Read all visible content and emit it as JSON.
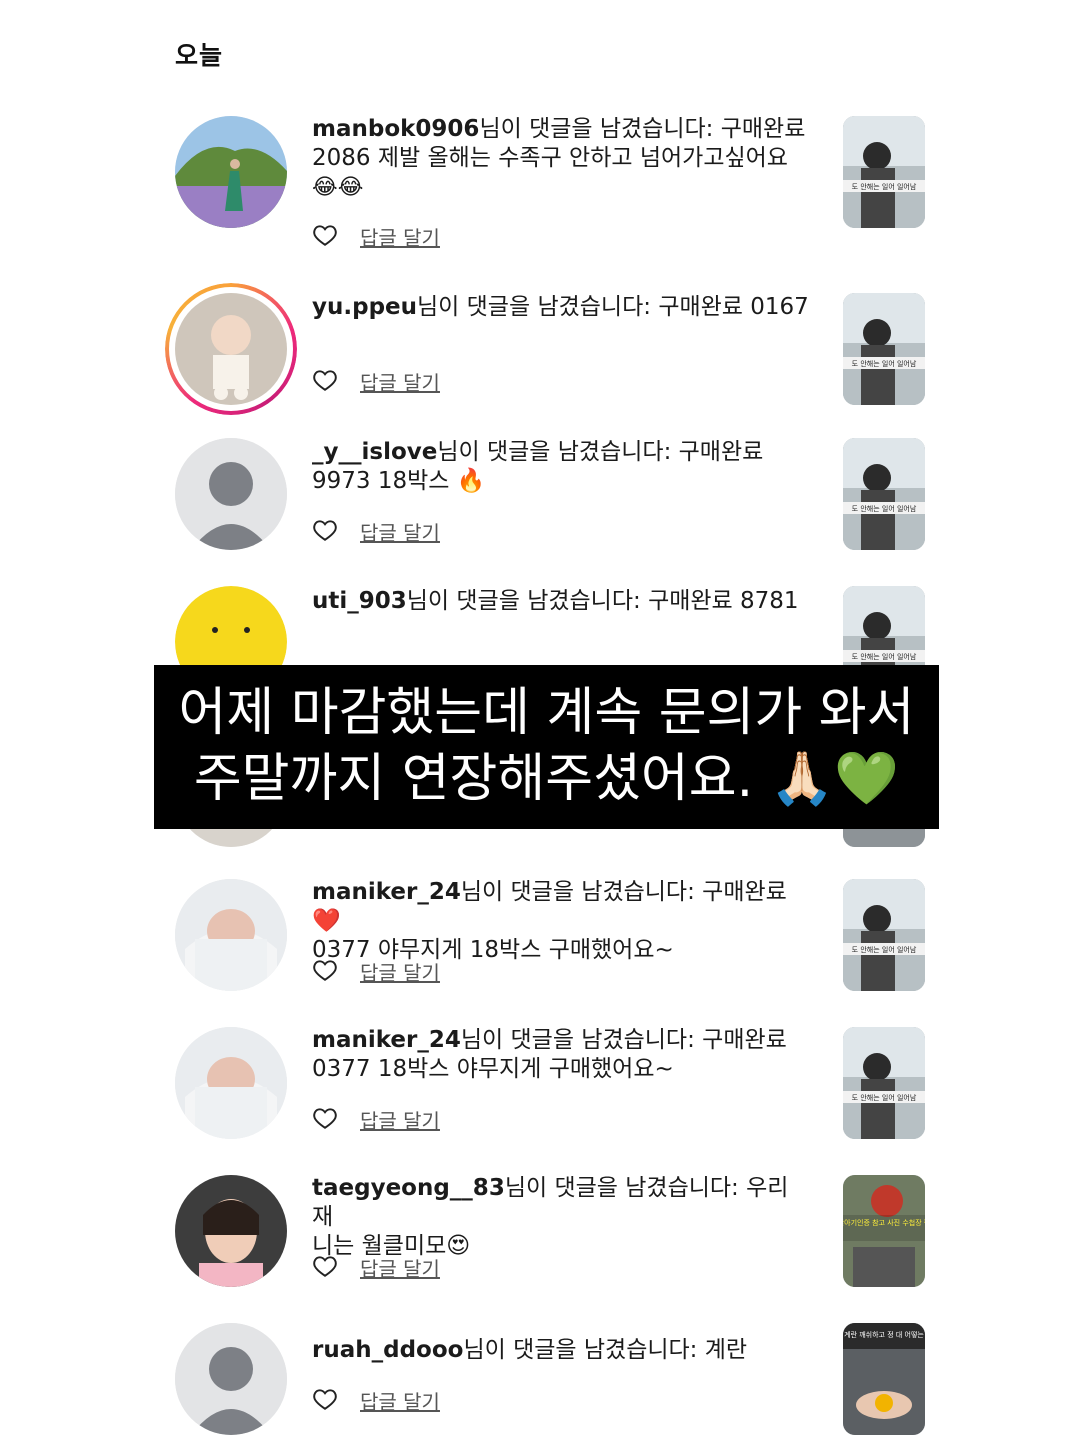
{
  "section_title": "오늘",
  "reply_label": "답글 달기",
  "comment_suffix": "님이 댓글을 남겼습니다: ",
  "notifications": [
    {
      "user": "manbok0906",
      "line1": "구매완료",
      "line2": "2086 제발 올해는 수족구 안하고 넘어가고싶어요",
      "line3": "😂😂"
    },
    {
      "user": "yu.ppeu",
      "line1": "구매완료 0167"
    },
    {
      "user": "_y__islove",
      "line1": "구매완료",
      "line2": "9973 18박스 🔥"
    },
    {
      "user": "uti_903",
      "line1": "구매완료 8781"
    },
    {
      "user": "maniker_24",
      "line1": "구매완료❤️",
      "line2": "0377 야무지게 18박스 구매했어요~"
    },
    {
      "user": "maniker_24",
      "line1": "구매완료",
      "line2": "0377 18박스 야무지게 구매했어요~"
    },
    {
      "user": "taegyeong__83",
      "line1": "우리 재",
      "line2": "니는 월클미모😍"
    },
    {
      "user": "ruah_ddooo",
      "line1": "계란"
    }
  ],
  "thumb_captions": {
    "baby_window": "도 안해는 일어 일어남",
    "taegyeong": "동글아기인증 참고 사진 수첩장 팩션",
    "egg": "마트 계란 깨쉬하고 정 대 어떻는 이유"
  },
  "banner": {
    "line1": "어제 마감했는데 계속 문의가 와서",
    "line2": "주말까지 연장해주셨어요. 🙏🏻💚"
  }
}
